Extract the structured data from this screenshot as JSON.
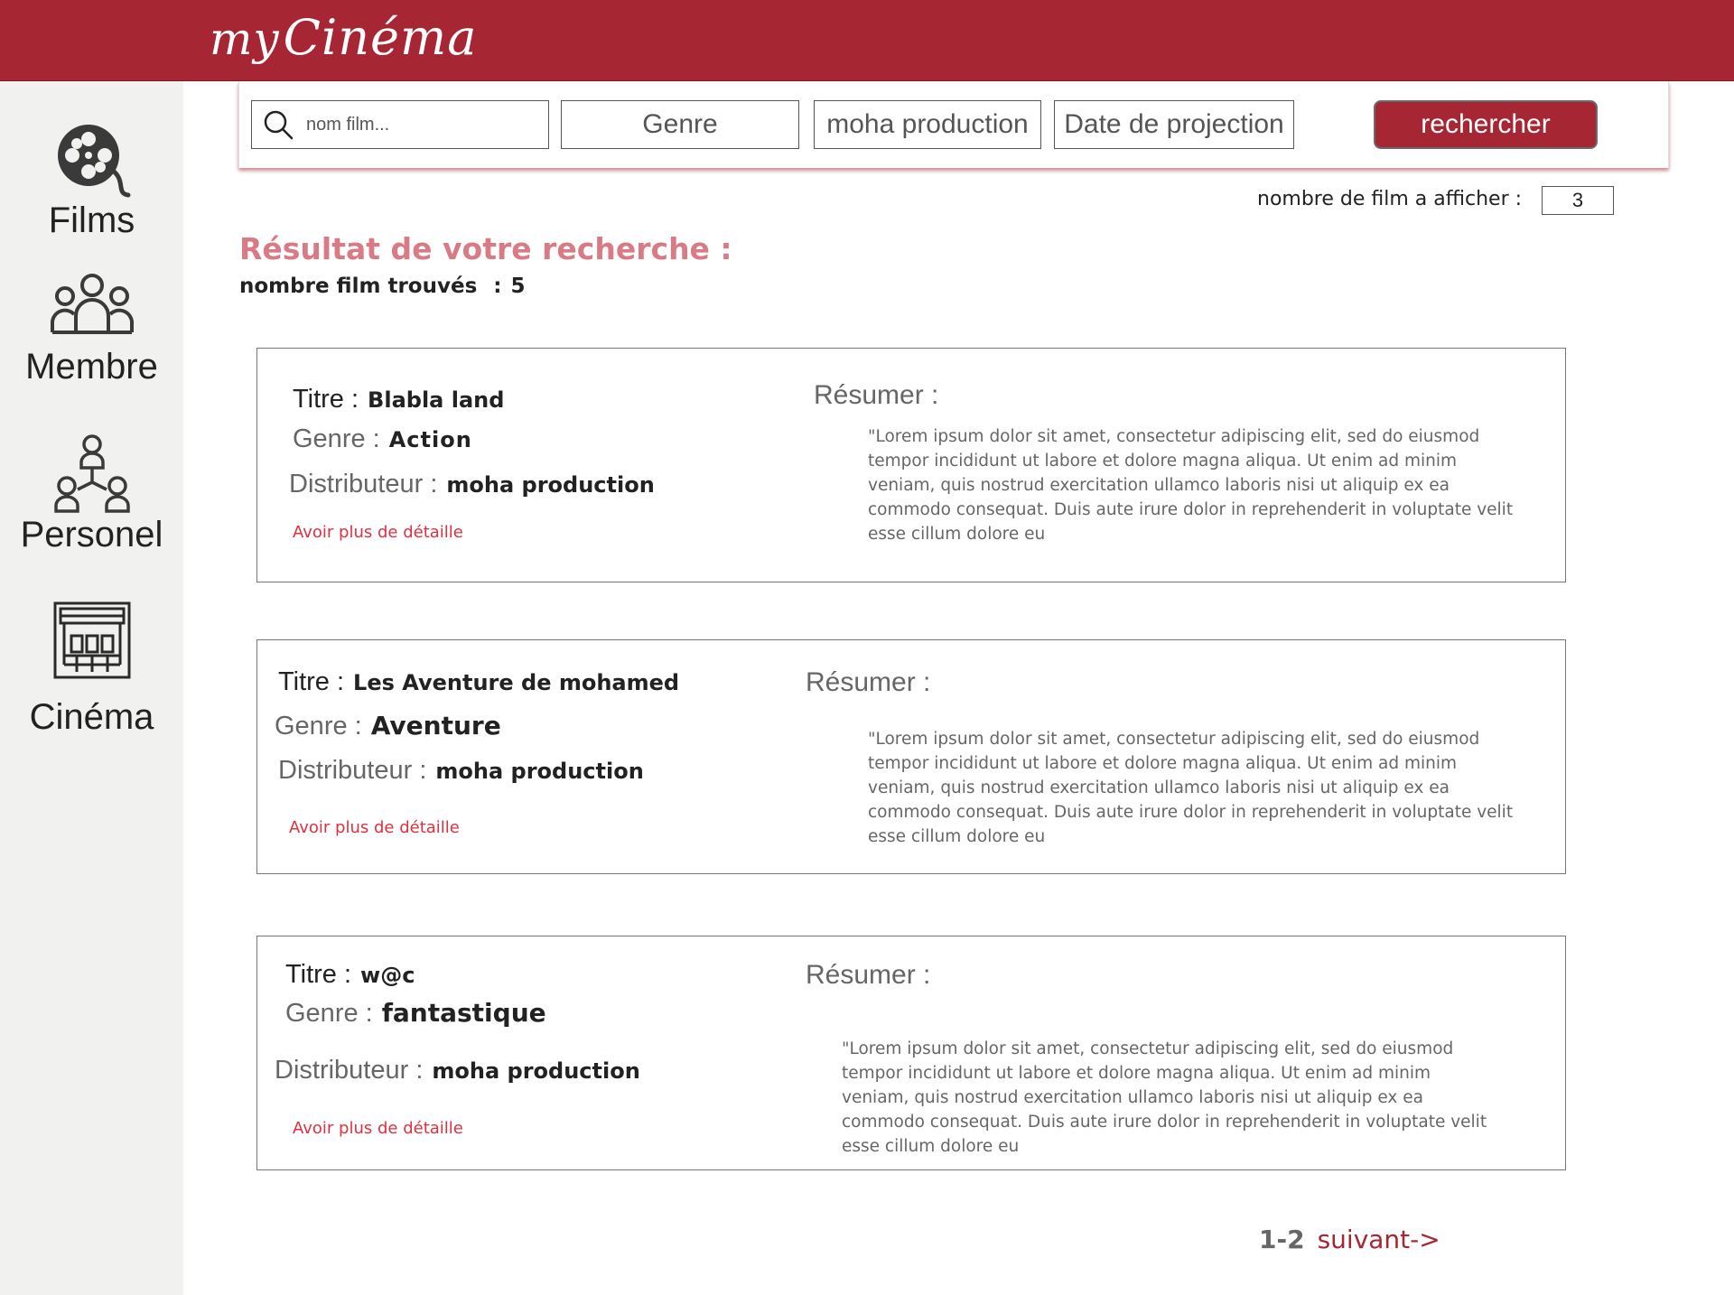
{
  "app": {
    "brand_my": "my",
    "brand_name": "Cinéma"
  },
  "sidebar": {
    "items": [
      {
        "label": "Films",
        "icon": "film-reel-icon"
      },
      {
        "label": "Membre",
        "icon": "group-icon"
      },
      {
        "label": "Personel",
        "icon": "org-chart-icon"
      },
      {
        "label": "Cinéma",
        "icon": "theater-icon"
      }
    ]
  },
  "search": {
    "placeholder": "nom film...",
    "genre": "Genre",
    "distributor": "moha production",
    "date": "Date de projection",
    "button": "rechercher"
  },
  "display_count": {
    "label": "nombre de film a afficher :",
    "value": "3"
  },
  "results": {
    "title": "Résultat de votre recherche :",
    "count_label": "nombre film trouvés",
    "count_sep": ":",
    "count_value": "5"
  },
  "labels": {
    "title": "Titre :",
    "genre": "Genre :",
    "distributor": "Distributeur :",
    "resume": "Résumer :",
    "more": "Avoir plus de détaille"
  },
  "films": [
    {
      "title": "Blabla land",
      "genre": "Action",
      "distributor": "moha production",
      "summary": "\"Lorem ipsum dolor sit amet, consectetur adipiscing elit, sed do eiusmod tempor incididunt ut labore et dolore magna aliqua. Ut enim ad minim veniam, quis nostrud exercitation ullamco laboris nisi ut aliquip ex ea commodo consequat. Duis aute irure dolor in reprehenderit in voluptate velit esse cillum dolore eu"
    },
    {
      "title": "Les Aventure de mohamed",
      "genre": "Aventure",
      "distributor": "moha production",
      "summary": "\"Lorem ipsum dolor sit amet, consectetur adipiscing elit, sed do eiusmod tempor incididunt ut labore et dolore magna aliqua. Ut enim ad minim veniam, quis nostrud exercitation ullamco laboris nisi ut aliquip ex ea commodo consequat. Duis aute irure dolor in reprehenderit in voluptate velit esse cillum dolore eu"
    },
    {
      "title": "w@c",
      "genre": "fantastique",
      "distributor": "moha production",
      "summary": "\"Lorem ipsum dolor sit amet, consectetur adipiscing elit, sed do eiusmod tempor incididunt ut labore et dolore magna aliqua. Ut enim ad minim veniam, quis nostrud exercitation ullamco laboris nisi ut aliquip ex ea commodo consequat. Duis aute irure dolor in reprehenderit in voluptate velit esse cillum dolore eu"
    }
  ],
  "pagination": {
    "pages": "1-2",
    "next": "suivant->"
  },
  "colors": {
    "brand": "#a62634",
    "accent_title": "#d97b85",
    "link": "#e03040"
  }
}
